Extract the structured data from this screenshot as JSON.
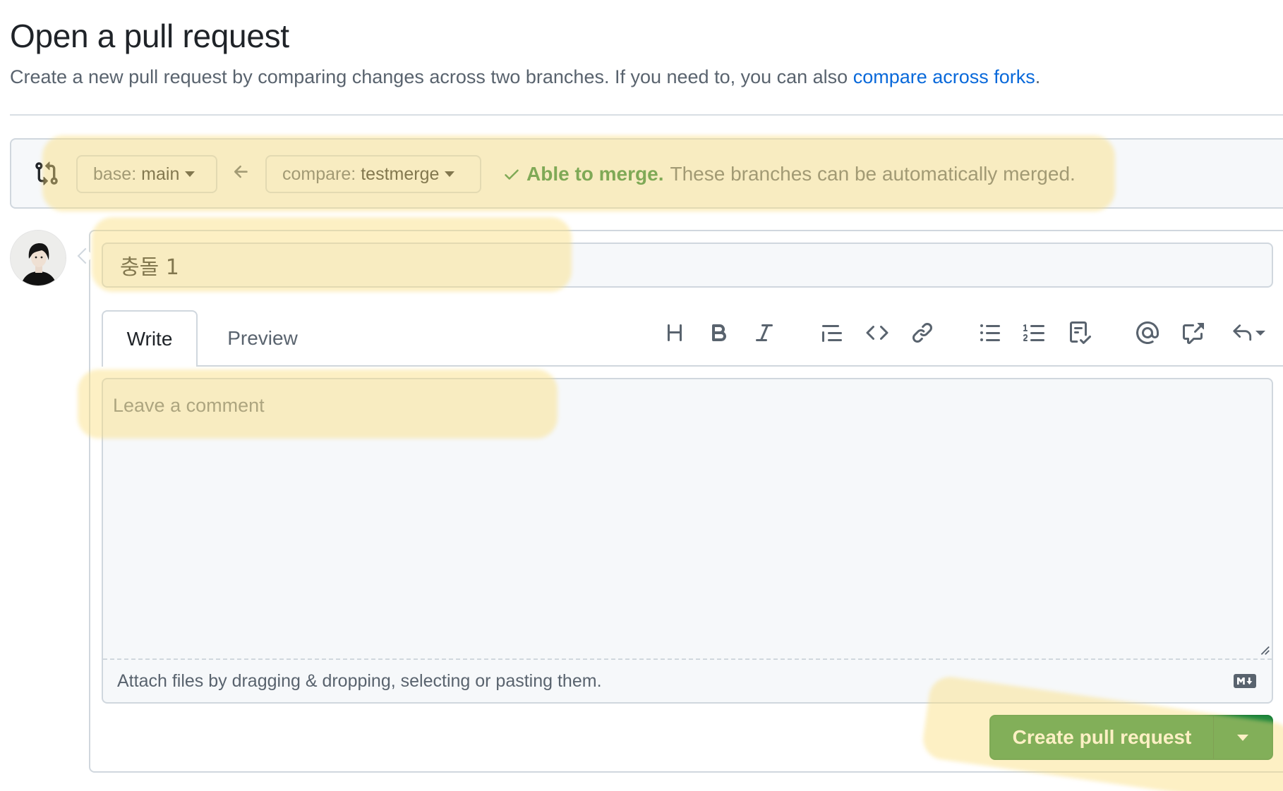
{
  "header": {
    "title": "Open a pull request",
    "subtitle": "Create a new pull request by comparing changes across two branches. If you need to, you can also ",
    "subtitle_link": "compare across forks",
    "subtitle_end": "."
  },
  "range": {
    "base_prefix": "base:",
    "base_branch": "main",
    "compare_prefix": "compare:",
    "compare_branch": "testmerge",
    "merge_status": "Able to merge.",
    "merge_message": "These branches can be automatically merged."
  },
  "form": {
    "title_value": "충돌 1",
    "tabs": {
      "write": "Write",
      "preview": "Preview"
    },
    "comment_placeholder": "Leave a comment",
    "attach_hint": "Attach files by dragging & dropping, selecting or pasting them.",
    "submit_label": "Create pull request"
  },
  "toolbar": {
    "icons": [
      "heading-icon",
      "bold-icon",
      "italic-icon",
      "quote-icon",
      "code-icon",
      "link-icon",
      "unordered-list-icon",
      "ordered-list-icon",
      "task-list-icon",
      "mention-icon",
      "cross-reference-icon",
      "reply-icon"
    ]
  },
  "colors": {
    "accent_blue": "#0969da",
    "success_green": "#1a7f37",
    "button_green": "#1f883d",
    "highlight": "#fade7d"
  }
}
